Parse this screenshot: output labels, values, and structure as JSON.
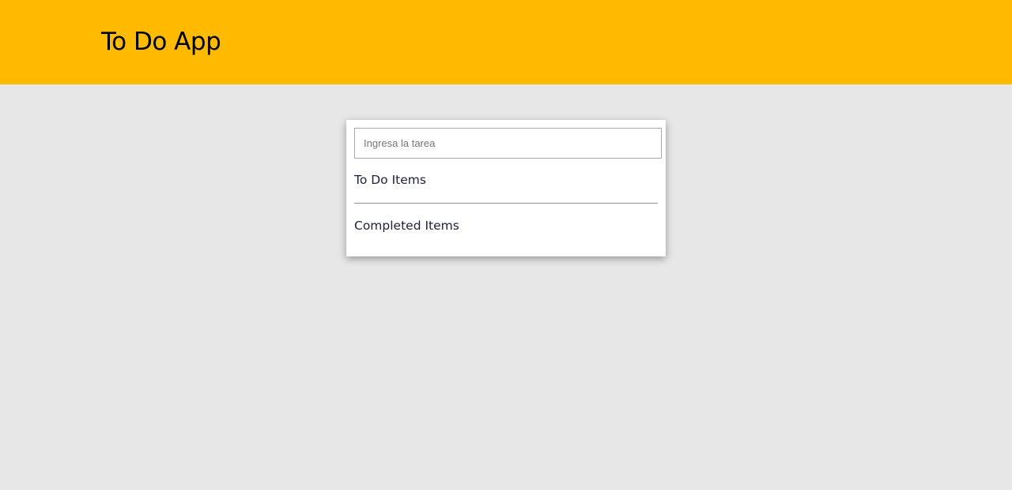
{
  "header": {
    "title": "To Do App",
    "background_color": "#ffbb00"
  },
  "todo_card": {
    "task_input": {
      "value": "",
      "placeholder": "Ingresa la tarea"
    },
    "todo_section": {
      "heading": "To Do Items",
      "items": []
    },
    "completed_section": {
      "heading": "Completed Items",
      "items": []
    }
  },
  "colors": {
    "page_background": "#e7e7e7",
    "card_background": "#ffffff",
    "heading_text": "#1f1f3a"
  }
}
